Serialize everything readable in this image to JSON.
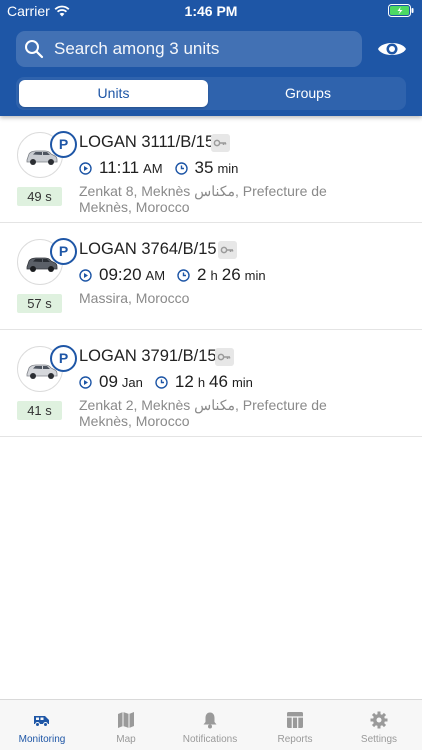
{
  "status_bar": {
    "carrier": "Carrier",
    "time": "1:46 PM"
  },
  "header": {
    "search_placeholder": "Search among 3 units",
    "segments": [
      {
        "label": "Units",
        "selected": true
      },
      {
        "label": "Groups",
        "selected": false
      }
    ]
  },
  "units": [
    {
      "name": "LOGAN 3111/B/15",
      "badge": "P",
      "age": "49 s",
      "time_value": "11:11",
      "time_unit": "AM",
      "duration": [
        {
          "v": "35",
          "u": "min"
        }
      ],
      "address": "Zenkat 8, Meknès مكناس, Prefecture de Meknès, Morocco"
    },
    {
      "name": "LOGAN 3764/B/15",
      "badge": "P",
      "age": "57 s",
      "time_value": "09:20",
      "time_unit": "AM",
      "duration": [
        {
          "v": "2",
          "u": "h"
        },
        {
          "v": "26",
          "u": "min"
        }
      ],
      "address": "Massira, Morocco"
    },
    {
      "name": "LOGAN 3791/B/15",
      "badge": "P",
      "age": "41 s",
      "time_value": "09",
      "time_unit": "Jan",
      "duration": [
        {
          "v": "12",
          "u": "h"
        },
        {
          "v": "46",
          "u": "min"
        }
      ],
      "address": "Zenkat 2, Meknès مكناس, Prefecture de Meknès, Morocco"
    }
  ],
  "tabbar": {
    "items": [
      {
        "label": "Monitoring",
        "icon": "van-icon",
        "active": true
      },
      {
        "label": "Map",
        "icon": "map-icon",
        "active": false
      },
      {
        "label": "Notifications",
        "icon": "bell-icon",
        "active": false
      },
      {
        "label": "Reports",
        "icon": "reports-icon",
        "active": false
      },
      {
        "label": "Settings",
        "icon": "gear-icon",
        "active": false
      }
    ]
  },
  "colors": {
    "brand": "#1e56a6",
    "age_badge_bg": "#dff1df",
    "tab_inactive": "#9a9a9a"
  }
}
